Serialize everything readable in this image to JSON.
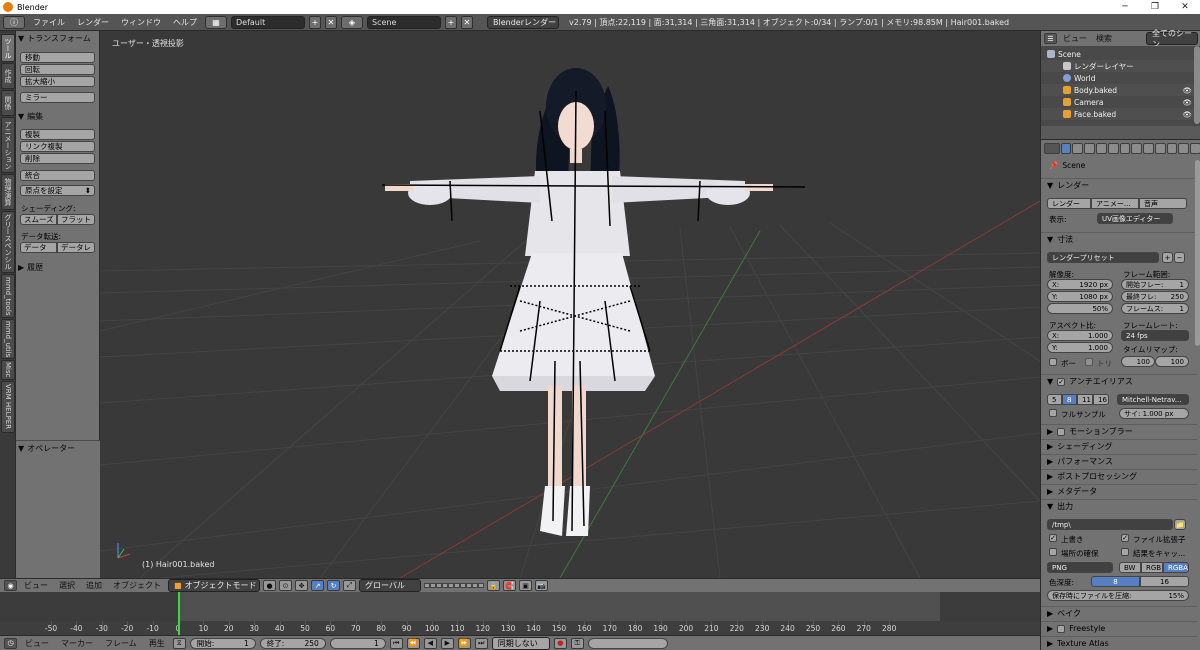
{
  "window": {
    "title": "Blender",
    "minimize": "─",
    "maximize": "❐",
    "close": "✕"
  },
  "info": {
    "menus": [
      "ファイル",
      "レンダー",
      "ウィンドウ",
      "ヘルプ"
    ],
    "layout": "Default",
    "scene": "Scene",
    "engine": "Blenderレンダー",
    "stats": "v2.79 | 頂点:22,119 | 面:31,314 | 三角面:31,314 | オブジェクト:0/34 | ランプ:0/1 | メモリ:98.85M | Hair001.baked"
  },
  "left_tabs": [
    "ツール",
    "作成",
    "関係",
    "アニメーション",
    "物理演算",
    "グリースペンシル",
    "mmd_tools",
    "mmd_utils",
    "Misc",
    "VRM HELPER"
  ],
  "toolshelf": {
    "transform_header": "トランスフォーム",
    "transform_buttons": [
      "移動",
      "回転",
      "拡大縮小"
    ],
    "mirror": "ミラー",
    "edit_header": "編集",
    "edit_buttons": [
      "複製",
      "リンク複製",
      "削除"
    ],
    "join": "統合",
    "origin": "原点を設定",
    "shading_label": "シェーディング:",
    "smooth": "スムーズ",
    "flat": "フラット",
    "transfer_label": "データ転送:",
    "data": "データ",
    "data2": "データレ",
    "history": "履歴",
    "operator": "オペレーター"
  },
  "viewport": {
    "label": "ユーザー・透視投影",
    "object": "(1) Hair001.baked"
  },
  "view3d_header": {
    "menus": [
      "ビュー",
      "選択",
      "追加",
      "オブジェクト"
    ],
    "mode": "オブジェクトモード",
    "orientation": "グローバル"
  },
  "timeline": {
    "ticks": [
      -50,
      -40,
      -30,
      -20,
      -10,
      0,
      10,
      20,
      30,
      40,
      50,
      60,
      70,
      80,
      90,
      100,
      110,
      120,
      130,
      140,
      150,
      160,
      170,
      180,
      190,
      200,
      210,
      220,
      230,
      240,
      250,
      260,
      270,
      280
    ],
    "current_frame": 1,
    "menus": [
      "ビュー",
      "マーカー",
      "フレーム",
      "再生"
    ],
    "start_label": "開始:",
    "start": "1",
    "end_label": "終了:",
    "end": "250",
    "frame": "1",
    "sync": "同期しない"
  },
  "outliner": {
    "menus": [
      "ビュー",
      "検索"
    ],
    "filter": "全てのシーン",
    "items": [
      "Scene",
      "レンダーレイヤー",
      "World",
      "Body.baked",
      "Camera",
      "Face.baked"
    ]
  },
  "properties": {
    "context": "Scene",
    "render_header": "レンダー",
    "render_btn": "レンダー",
    "anim_btn": "アニメー...",
    "audio_btn": "音声",
    "display_label": "表示:",
    "display_value": "UV画像エディター",
    "dims_header": "寸法",
    "preset": "レンダープリセット",
    "resolution_label": "解像度:",
    "res_x_label": "X:",
    "res_x": "1920 px",
    "res_y_label": "Y:",
    "res_y": "1080 px",
    "res_pct": "50%",
    "frame_range_label": "フレーム範囲:",
    "start_frame_label": "開始フレー:",
    "start_frame": "1",
    "end_frame_label": "最終フレ:",
    "end_frame": "250",
    "step_label": "フレームス:",
    "step": "1",
    "aspect_label": "アスペクト比:",
    "asp_x_label": "X:",
    "asp_x": "1.000",
    "asp_y_label": "Y:",
    "asp_y": "1.000",
    "fps_label": "フレームレート:",
    "fps": "24 fps",
    "timemap_label": "タイムリマップ:",
    "tm_old": "100",
    "tm_new": "100",
    "border": "ボー",
    "crop": "トリ",
    "aa_header": "アンチエイリアス",
    "aa_samples": [
      "5",
      "8",
      "11",
      "16"
    ],
    "aa_filter": "Mitchell-Netrav...",
    "full_sample": "フルサンプル",
    "filter_size": "サイ: 1.000 px",
    "motion_blur": "モーションブラー",
    "sections": [
      "シェーディング",
      "パフォーマンス",
      "ポストプロセッシング",
      "メタデータ"
    ],
    "output_header": "出力",
    "output_path": "/tmp\\",
    "overwrite": "上書き",
    "file_ext": "ファイル拡張子",
    "placeholders": "場所の確保",
    "cache_result": "結果をキャッ...",
    "format": "PNG",
    "bw": "BW",
    "rgb": "RGB",
    "rgba": "RGBA",
    "depth_label": "色深度:",
    "depth8": "8",
    "depth16": "16",
    "compression": "保存時にファイルを圧縮:",
    "compression_val": "15%",
    "bake": "ベイク",
    "freestyle": "Freestyle",
    "texture_atlas": "Texture Atlas"
  },
  "colors": {
    "accent": "#5680c2",
    "playhead": "#3fd73f",
    "viewport_bg": "#393939",
    "panel_bg": "#727272"
  }
}
